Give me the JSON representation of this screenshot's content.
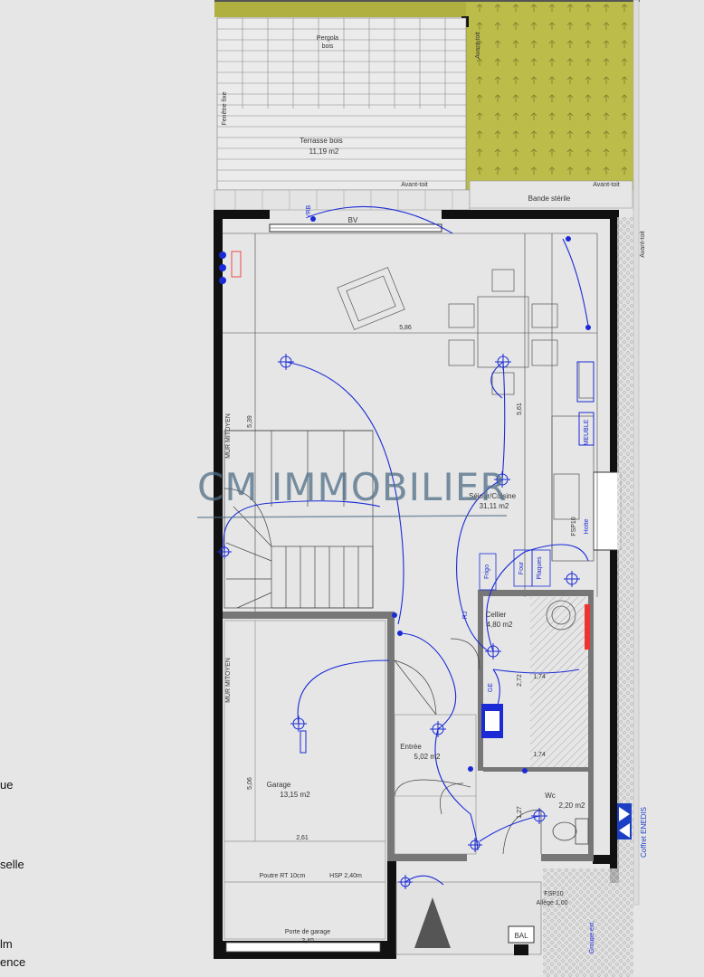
{
  "side_text": [
    "ue",
    "selle",
    "lm",
    "ence"
  ],
  "exterior": {
    "pergola": "Pergola\nbois",
    "terrasse": "Terrasse bois",
    "terrasse_area": "11,19 m2",
    "avant_toit_top": "Avant-toit",
    "avant_toit_right_top": "Avant-toit",
    "avant_toit_right": "Avant-toit",
    "bande_sterile": "Bande stérile",
    "bv": "BV",
    "vrb": "VRB",
    "coffret_enedis": "Coffret ENEDIS",
    "fenetre_left": "Fenêtre fixe",
    "avant_toit_left": "Avant-toit",
    "bal": "BAL",
    "groupe_ext": "Groupe ext.",
    "fsp_label": "FSP10",
    "allege": "Allège 1,00"
  },
  "rooms": {
    "sejour_name": "Séjour/Cuisine",
    "sejour_area": "31,11 m2",
    "cellier_name": "Cellier",
    "cellier_area": "4,80 m2",
    "entree_name": "Entrée",
    "entree_area": "5,02 m2",
    "wc_name": "Wc",
    "wc_area": "2,20 m2",
    "garage_name": "Garage",
    "garage_area": "13,15 m2"
  },
  "dims": {
    "sejour_width": "5,86",
    "sejour_depth_left": "5,39",
    "sejour_depth_right": "5,61",
    "garage_depth": "5,06",
    "garage_width": "2,61",
    "cellier_w1": "1,74",
    "cellier_w2": "1,74",
    "cellier_h": "2,72",
    "wc_h": "1,27",
    "poutre": "Poutre RT 10cm",
    "hsp": "HSP 2,40m",
    "porte_garage": "Porte de garage",
    "porte_garage_w": "2,40"
  },
  "walls": {
    "mur_mitoyen_top": "MUR MITOYEN",
    "mur_mitoyen_bottom": "MUR MITOYEN"
  },
  "equipment": {
    "meuble": "MEUBLE",
    "fsp_right": "FSP10",
    "hotte": "Hotte",
    "frigo": "Frigo",
    "plaques": "Plaques",
    "four": "Four",
    "tableau": "TGBT",
    "ge": "GE",
    "rj": "RJ"
  },
  "watermark": "CM IMMOBILIER"
}
